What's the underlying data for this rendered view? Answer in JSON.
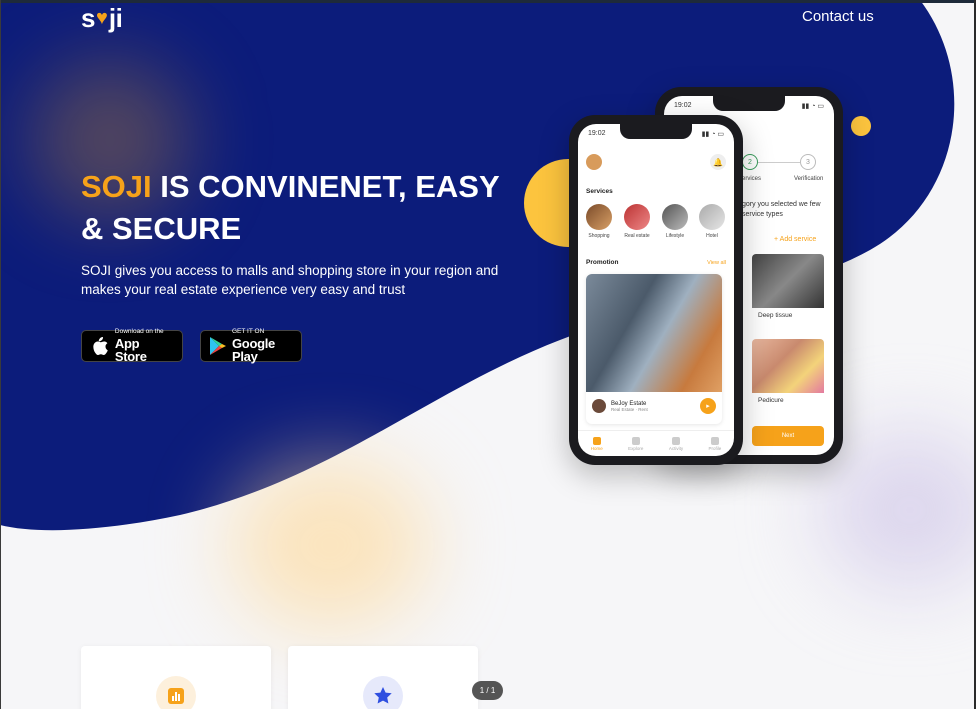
{
  "brand": {
    "logo_left": "s",
    "logo_right": "ji",
    "accent": "#f6a21a",
    "navy": "#0c1c7b"
  },
  "nav": {
    "contact": "Contact us"
  },
  "hero": {
    "headline_accent": "SOJI",
    "headline_rest_1": " IS CONVINENET, EASY",
    "headline_rest_2": "& SECURE",
    "subtext": "SOJI gives you access to malls and shopping store in your region and makes your real estate experience very easy and trust"
  },
  "stores": {
    "apple": {
      "small": "Download on the",
      "big": "App Store",
      "icon": "apple-icon"
    },
    "google": {
      "small": "GET IT ON",
      "big": "Google Play",
      "icon": "google-play-icon"
    }
  },
  "phone_back": {
    "time": "19:02",
    "step2": "2",
    "step3": "3",
    "step_label_1": "ervices",
    "step_label_2": "Verification",
    "desc": "gory you selected we few service types",
    "add_service": "+ Add service",
    "card1": "Deep tissue",
    "card2": "Pedicure",
    "next": "Next"
  },
  "phone_front": {
    "time": "19:02",
    "services_title": "Services",
    "services": [
      "Shopping",
      "Real estate",
      "Lifestyle",
      "Hotel"
    ],
    "promotion_title": "Promotion",
    "view_all": "View all",
    "promo_name": "BeJoy Estate",
    "promo_sub": "Real Estate · Rent",
    "tabs": [
      "Home",
      "Explore",
      "Activity",
      "Profile"
    ]
  },
  "pager": "1 / 1"
}
